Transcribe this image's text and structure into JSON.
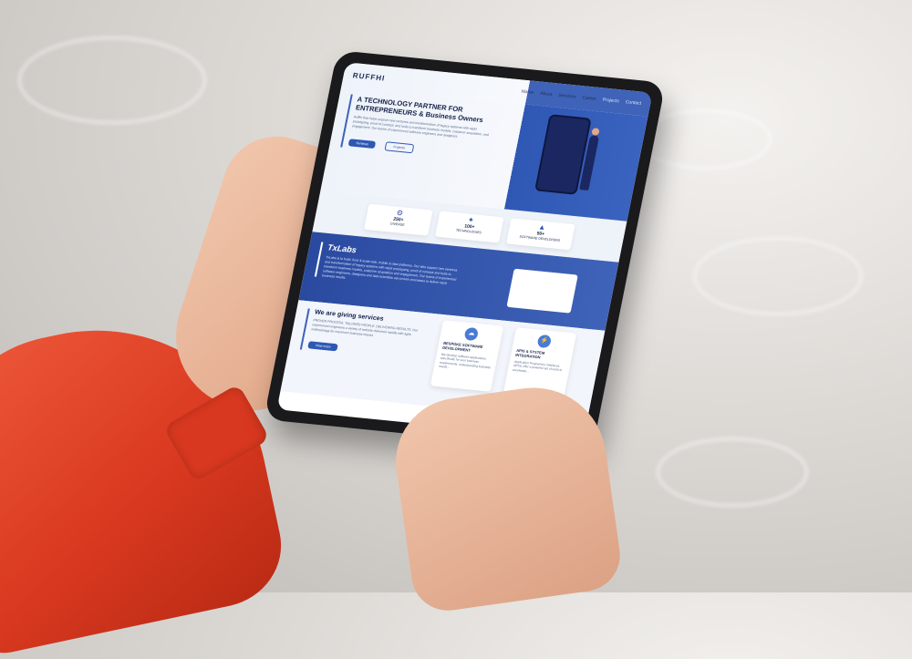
{
  "nav": {
    "logo": "RUFFHI",
    "links": [
      "Home",
      "About",
      "Services",
      "Career",
      "Projects",
      "Contact"
    ]
  },
  "hero": {
    "title": "A TECHNOLOGY PARTNER FOR ENTREPRENEURS & Business Owners",
    "description": "Ruffhi that helps support new ventures and transformation of legacy systems with rapid prototyping, proof of concept, and tools to transform business models, customer acquisition, and engagement. Our teams of experienced software engineers and designers.",
    "primary_button": "Services",
    "secondary_button": "Projects"
  },
  "stats": [
    {
      "value": "250+",
      "label": "DIVERSE",
      "icon": "gear-icon"
    },
    {
      "value": "100+",
      "label": "TECHNOLOGIES",
      "icon": "tech-icon"
    },
    {
      "value": "50+",
      "label": "SOFTWARE DEVELOPERS",
      "icon": "developer-icon"
    }
  ],
  "txlabs": {
    "title": "TxLabs",
    "description": "TxLabs is to build, fund & scale web, mobile & data platforms. Our labs support new ventures and transformation of legacy systems with rapid prototyping, proof of concept and tools to transform business models, customer acquisition and engagement. Our teams of experienced software engineers, designers and data scientists use proven processes to deliver rapid business results."
  },
  "services": {
    "title": "We are giving services",
    "description": "PROVEN PROCESS. TAILORED PEOPLE. DELIVERING RESULTS. Our experienced engineers a variety of website delivered rapidly with agile methodology for maximum business impact.",
    "button": "View more",
    "cards": [
      {
        "title": "BESPOKE SOFTWARE DEVELOPMENT",
        "text": "We develop software applications specifically for your business requirements, understanding business needs..."
      },
      {
        "title": "APIS & SYSTEM INTEGRATION",
        "text": "Application Programme Interfaces (APIs) offer a powerful set of tools to accelerate..."
      }
    ]
  },
  "colors": {
    "accent": "#2f58b5",
    "navy": "#16224a",
    "sleeve": "#d8381f"
  }
}
